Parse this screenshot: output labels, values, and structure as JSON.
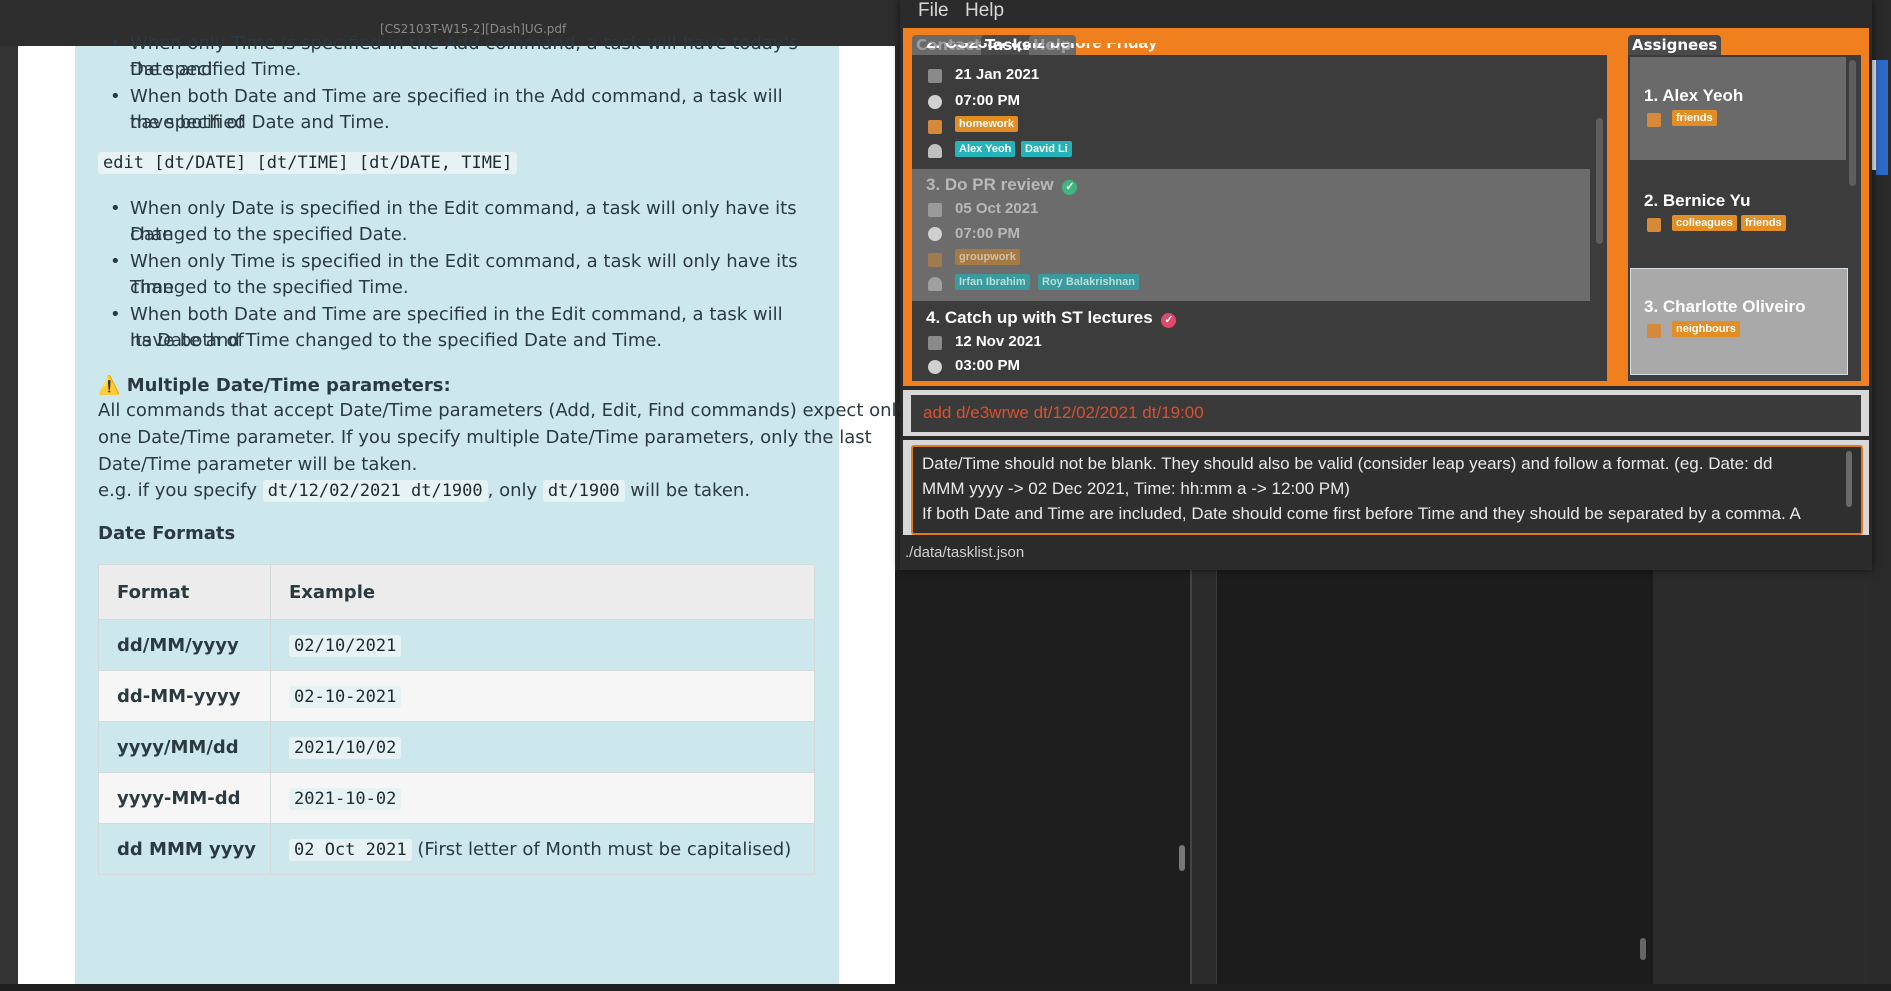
{
  "pdf": {
    "window_title": "[CS2103T-W15-2][Dash]UG.pdf",
    "top_bullets": [
      "When only Time is specified in the Add command, a task will have today's Date and",
      "the specified Time.",
      "When both Date and Time are specified in the Add command, a task will have both of",
      "the specified Date and Time."
    ],
    "edit_syntax": "edit [dt/DATE] [dt/TIME] [dt/DATE, TIME]",
    "edit_bullets": [
      [
        "When only Date is specified in the Edit command, a task will only have its Date",
        "changed to the specified Date."
      ],
      [
        "When only Time is specified in the Edit command, a task will only have its Time",
        "changed to the specified Time."
      ],
      [
        "When both Date and Time are specified in the Edit command, a task will have both of",
        "its Date and Time changed to the specified Date and Time."
      ]
    ],
    "warning_heading": "Multiple Date/Time parameters:",
    "warning_lines": [
      "All commands that accept Date/Time parameters (Add, Edit, Find commands) expect only",
      "one Date/Time parameter. If you specify multiple Date/Time parameters, only the last",
      "Date/Time parameter will be taken."
    ],
    "example_prefix": "e.g. if you specify",
    "example_code1": "dt/12/02/2021 dt/1900",
    "example_mid": ", only",
    "example_code2": "dt/1900",
    "example_suffix": "will be taken.",
    "date_formats_heading": "Date Formats",
    "table_headers": [
      "Format",
      "Example"
    ],
    "table_rows": [
      {
        "format": "dd/MM/yyyy",
        "example": "02/10/2021",
        "note": ""
      },
      {
        "format": "dd-MM-yyyy",
        "example": "02-10-2021",
        "note": ""
      },
      {
        "format": "yyyy/MM/dd",
        "example": "2021/10/02",
        "note": ""
      },
      {
        "format": "yyyy-MM-dd",
        "example": "2021-10-02",
        "note": ""
      },
      {
        "format": "dd MMM yyyy",
        "example": "02 Oct 2021",
        "note": "(First letter of Month must be capitalised)"
      }
    ]
  },
  "app": {
    "menu": {
      "file": "File",
      "help": "Help"
    },
    "tabs": {
      "contacts": "Contacts",
      "tasks": "Tasks",
      "help": "Help",
      "assignees": "Assignees"
    },
    "tasks": [
      {
        "title": "2. CS2334 quiz before Friday",
        "date": "21 Jan 2021",
        "time": "07:00 PM",
        "tags": [
          "homework"
        ],
        "people": [
          "Alex Yeoh",
          "David Li"
        ],
        "done": false
      },
      {
        "title": "3.  Do PR review",
        "date": "05 Oct 2021",
        "time": "07:00 PM",
        "tags": [
          "groupwork"
        ],
        "people": [
          "Irfan Ibrahim",
          "Roy Balakrishnan"
        ],
        "done": true
      },
      {
        "title": "4.  Catch up with ST lectures",
        "date": "12 Nov 2021",
        "time": "03:00 PM",
        "tags": [],
        "people": [],
        "done": false
      }
    ],
    "assignees": [
      {
        "name": "1.  Alex Yeoh",
        "tags": [
          "friends"
        ]
      },
      {
        "name": "2.  Bernice Yu",
        "tags": [
          "colleagues",
          "friends"
        ]
      },
      {
        "name": "3.  Charlotte Oliveiro",
        "tags": [
          "neighbours"
        ]
      }
    ],
    "command_input": "add d/e3wrwe dt/12/02/2021 dt/19:00",
    "result_lines": [
      "Date/Time should not be blank. They should also be valid (consider leap years) and follow a format. (eg. Date: dd",
      "MMM yyyy -> 02 Dec 2021, Time: hh:mm a -> 12:00 PM)",
      "If both Date and Time are included, Date should come first before Time and they should be separated by a comma. A"
    ],
    "status_path": "./data/tasklist.json"
  }
}
